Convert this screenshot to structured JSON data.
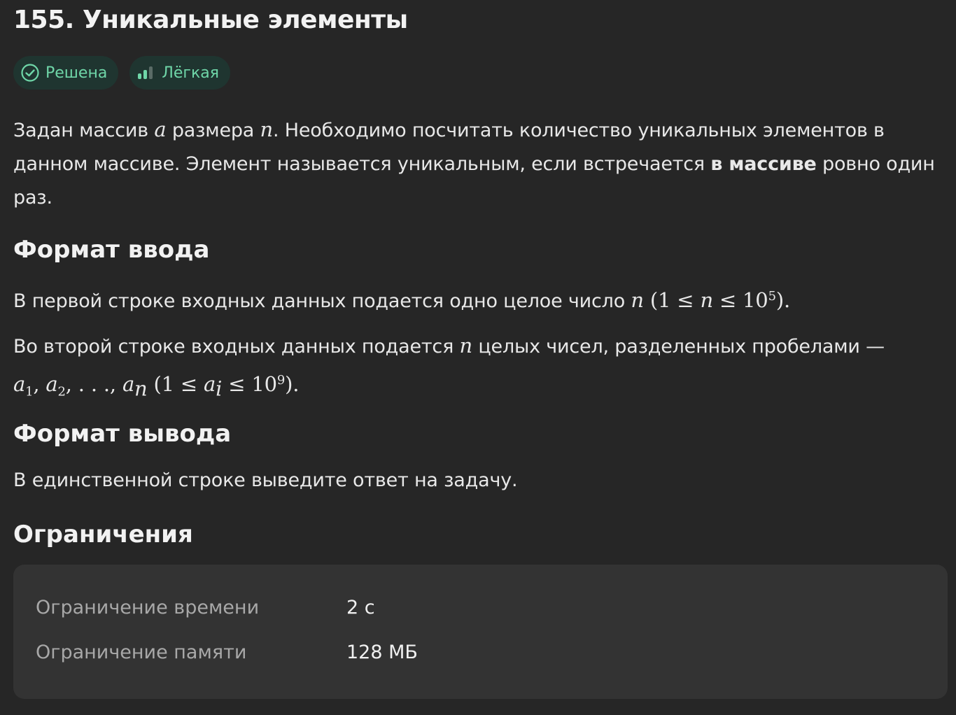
{
  "problem": {
    "title": "155. Уникальные элементы",
    "badges": {
      "status": "Решена",
      "difficulty": "Лёгкая"
    }
  },
  "statement": {
    "p1_a": "Задан массив ",
    "var_a": "a",
    "p1_b": " размера ",
    "var_n": "n",
    "p1_c": ". Необходимо посчитать количество уникальных элементов в данном массиве. Элемент называется уникальным, если встречается ",
    "p1_bold": "в массиве",
    "p1_d": " ровно один раз."
  },
  "input_format": {
    "heading": "Формат ввода",
    "line1_text": "В первой строке входных данных подается одно целое число ",
    "line1_var": "n",
    "line1_math_open": " (1 ≤ ",
    "line1_math_var": "n",
    "line1_math_mid": " ≤ 10",
    "line1_math_exp": "5",
    "line1_math_close": ").",
    "line2_text_a": "Во второй строке входных данных подается ",
    "line2_var": "n",
    "line2_text_b": " целых чисел, разделенных пробелами —",
    "line2_a": "a",
    "line2_sub1": "1",
    "line2_sub2": "2",
    "line2_subn": "n",
    "line2_comma": ", ",
    "line2_dots": ", . . ., ",
    "line2_open": " (1 ≤ ",
    "line2_ai": "a",
    "line2_sub_i": "i",
    "line2_mid": " ≤ 10",
    "line2_exp": "9",
    "line2_close": ")."
  },
  "output_format": {
    "heading": "Формат вывода",
    "text": "В единственной строке выведите ответ на задачу."
  },
  "limits": {
    "heading": "Ограничения",
    "time_label": "Ограничение времени",
    "time_value": "2 с",
    "memory_label": "Ограничение памяти",
    "memory_value": "128 МБ"
  },
  "colors": {
    "background": "#262626",
    "badge_bg": "#1f3530",
    "badge_text": "#6fd6a8",
    "panel_bg": "#333333"
  }
}
